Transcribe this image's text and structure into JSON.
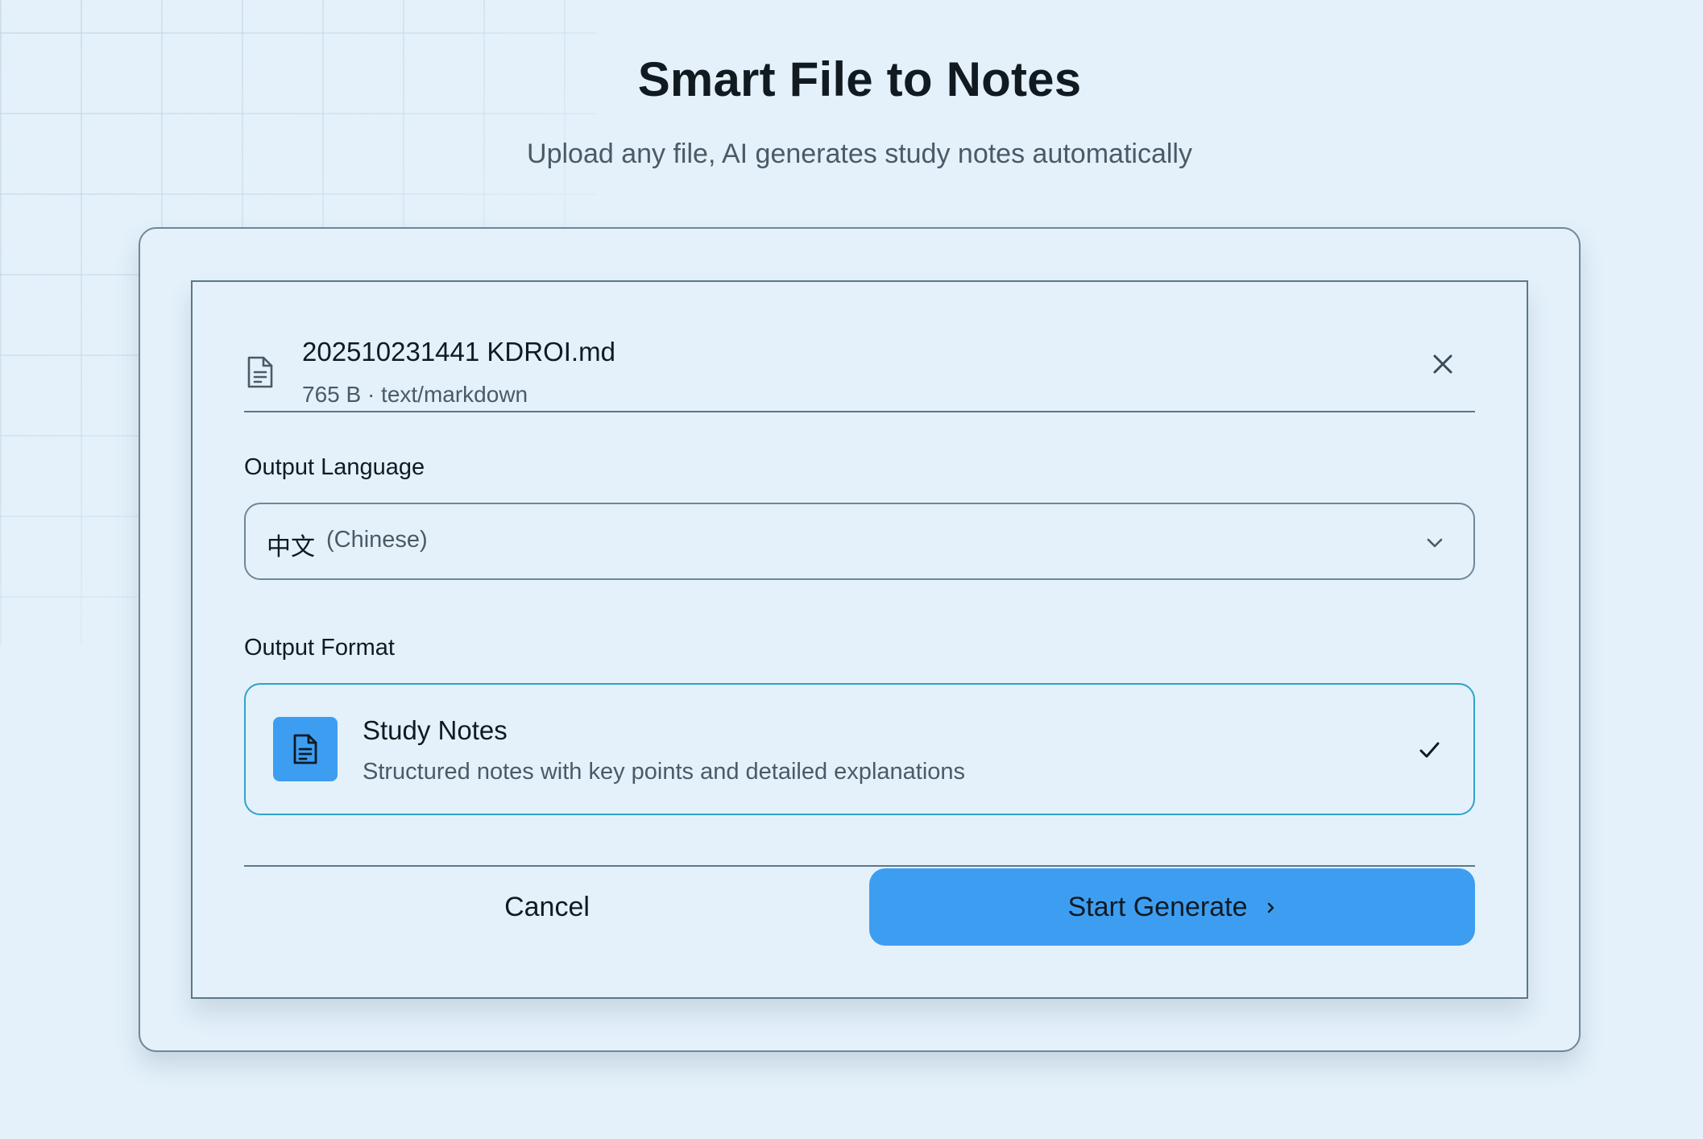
{
  "header": {
    "title": "Smart File to Notes",
    "subtitle": "Upload any file, AI generates study notes automatically"
  },
  "file": {
    "name": "202510231441 KDROI.md",
    "meta": "765 B · text/markdown",
    "icon": "file-text-icon"
  },
  "language": {
    "label": "Output Language",
    "selected_native": "中文",
    "selected_english": "(Chinese)"
  },
  "format": {
    "label": "Output Format",
    "selected": {
      "title": "Study Notes",
      "description": "Structured notes with key points and detailed explanations",
      "icon": "document-icon"
    }
  },
  "actions": {
    "cancel_label": "Cancel",
    "generate_label": "Start Generate"
  },
  "colors": {
    "background": "#e4f1fb",
    "accent": "#3d9ef1",
    "selected_border": "#2ea3c9",
    "border": "#6f8796"
  }
}
